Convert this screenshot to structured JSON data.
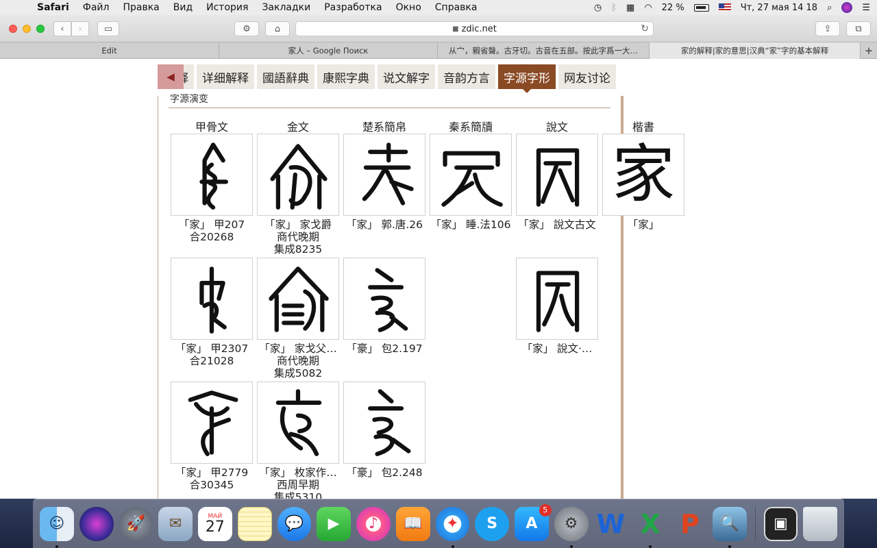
{
  "menubar": {
    "app_name": "Safari",
    "items": [
      "Файл",
      "Правка",
      "Вид",
      "История",
      "Закладки",
      "Разработка",
      "Окно",
      "Справка"
    ],
    "battery_percent": "22 %",
    "datetime": "Чт, 27 мая  14 18"
  },
  "toolbar": {
    "url": "zdic.net"
  },
  "tabs": [
    {
      "title": "Edit"
    },
    {
      "title": "家人 – Google Поиск"
    },
    {
      "title": "从宀，豭省聲。古牙切。古音在五部。按此字爲一大…"
    },
    {
      "title": "家的解释|家的意思|汉典“家”字的基本解释"
    }
  ],
  "nav": {
    "items": [
      "释",
      "详细解释",
      "國語辭典",
      "康熙字典",
      "说文解字",
      "音韵方言",
      "字源字形",
      "网友讨论"
    ],
    "active_index": 6
  },
  "section": {
    "title": "字源演变"
  },
  "columns": [
    "甲骨文",
    "金文",
    "楚系簡帛",
    "秦系簡牘",
    "說文",
    "楷書"
  ],
  "glyphs": [
    {
      "col": 0,
      "row": 0,
      "caption": [
        "「家」 甲207",
        "合20268"
      ]
    },
    {
      "col": 1,
      "row": 0,
      "caption": [
        "「家」 家戈爵",
        "商代晚期",
        "集成8235"
      ]
    },
    {
      "col": 2,
      "row": 0,
      "caption": [
        "「家」 郭.唐.26"
      ]
    },
    {
      "col": 3,
      "row": 0,
      "caption": [
        "「家」 睡.法106"
      ]
    },
    {
      "col": 4,
      "row": 0,
      "caption": [
        "「家」 說文古文"
      ]
    },
    {
      "col": 5,
      "row": 0,
      "caption": [
        "「家」"
      ],
      "char": "家"
    },
    {
      "col": 0,
      "row": 1,
      "caption": [
        "「家」 甲2307",
        "合21028"
      ]
    },
    {
      "col": 1,
      "row": 1,
      "caption": [
        "「家」 家戈父…",
        "商代晚期",
        "集成5082"
      ]
    },
    {
      "col": 2,
      "row": 1,
      "caption": [
        "「豪」 包2.197"
      ]
    },
    {
      "col": 4,
      "row": 1,
      "caption": [
        "「家」 說文‧…"
      ]
    },
    {
      "col": 0,
      "row": 2,
      "caption": [
        "「家」 甲2779",
        "合30345"
      ]
    },
    {
      "col": 1,
      "row": 2,
      "caption": [
        "「家」 枚家作…",
        "西周早期",
        "集成5310"
      ]
    },
    {
      "col": 2,
      "row": 2,
      "caption": [
        "「豪」 包2.248"
      ]
    }
  ],
  "dock": {
    "calendar_month": "МАЙ",
    "calendar_day": "27",
    "appstore_badge": "5"
  }
}
